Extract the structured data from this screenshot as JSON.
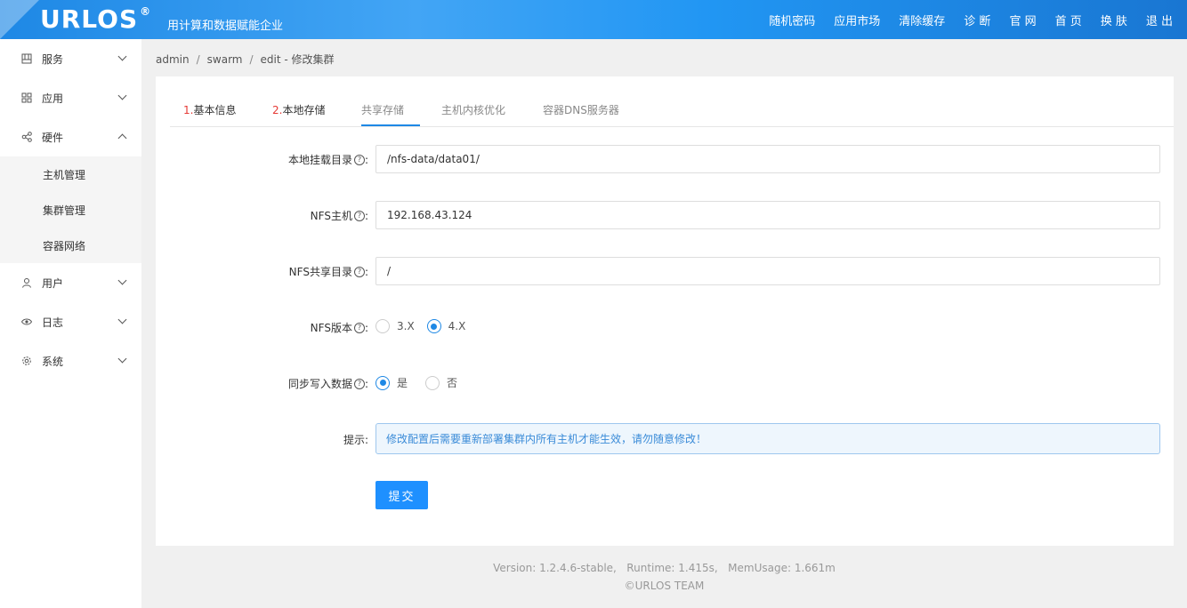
{
  "header": {
    "logo": "URLOS",
    "logo_mark": "®",
    "slogan": "用计算和数据赋能企业",
    "nav": [
      "随机密码",
      "应用市场",
      "清除缓存",
      "诊 断",
      "官 网",
      "首 页",
      "换 肤",
      "退 出"
    ]
  },
  "sidebar": {
    "items": [
      {
        "label": "服务",
        "icon": "grid-box-icon",
        "expanded": false
      },
      {
        "label": "应用",
        "icon": "apps-icon",
        "expanded": false
      },
      {
        "label": "硬件",
        "icon": "share-nodes-icon",
        "expanded": true
      },
      {
        "label": "用户",
        "icon": "user-icon",
        "expanded": false
      },
      {
        "label": "日志",
        "icon": "eye-icon",
        "expanded": false
      },
      {
        "label": "系统",
        "icon": "gear-icon",
        "expanded": false
      }
    ],
    "hardware_sub": [
      "主机管理",
      "集群管理",
      "容器网络"
    ]
  },
  "breadcrumb": [
    "admin",
    "swarm",
    "edit - 修改集群"
  ],
  "tabs": [
    {
      "num": "1.",
      "label": "基本信息"
    },
    {
      "num": "2.",
      "label": "本地存储"
    },
    {
      "num": "",
      "label": "共享存储"
    },
    {
      "num": "",
      "label": "主机内核优化"
    },
    {
      "num": "",
      "label": "容器DNS服务器"
    }
  ],
  "active_tab": "共享存储",
  "form": {
    "local_mount": {
      "label": "本地挂载目录",
      "value": "/nfs-data/data01/"
    },
    "nfs_host": {
      "label": "NFS主机",
      "value": "192.168.43.124"
    },
    "nfs_dir": {
      "label": "NFS共享目录",
      "value": "/"
    },
    "nfs_version": {
      "label": "NFS版本",
      "options": [
        "3.X",
        "4.X"
      ],
      "selected": "4.X"
    },
    "sync_write": {
      "label": "同步写入数据",
      "options": [
        "是",
        "否"
      ],
      "selected": "是"
    },
    "tip": {
      "label": "提示",
      "text": "修改配置后需要重新部署集群内所有主机才能生效，请勿随意修改！"
    },
    "submit_label": "提交"
  },
  "footer": {
    "version_line": "Version: 1.2.4.6-stable,   Runtime: 1.415s,   MemUsage: 1.661m",
    "copyright": "©URLOS TEAM"
  },
  "colors": {
    "accent": "#1e88e5",
    "tab_number": "#e53935",
    "notice_text": "#3a8bd8"
  }
}
